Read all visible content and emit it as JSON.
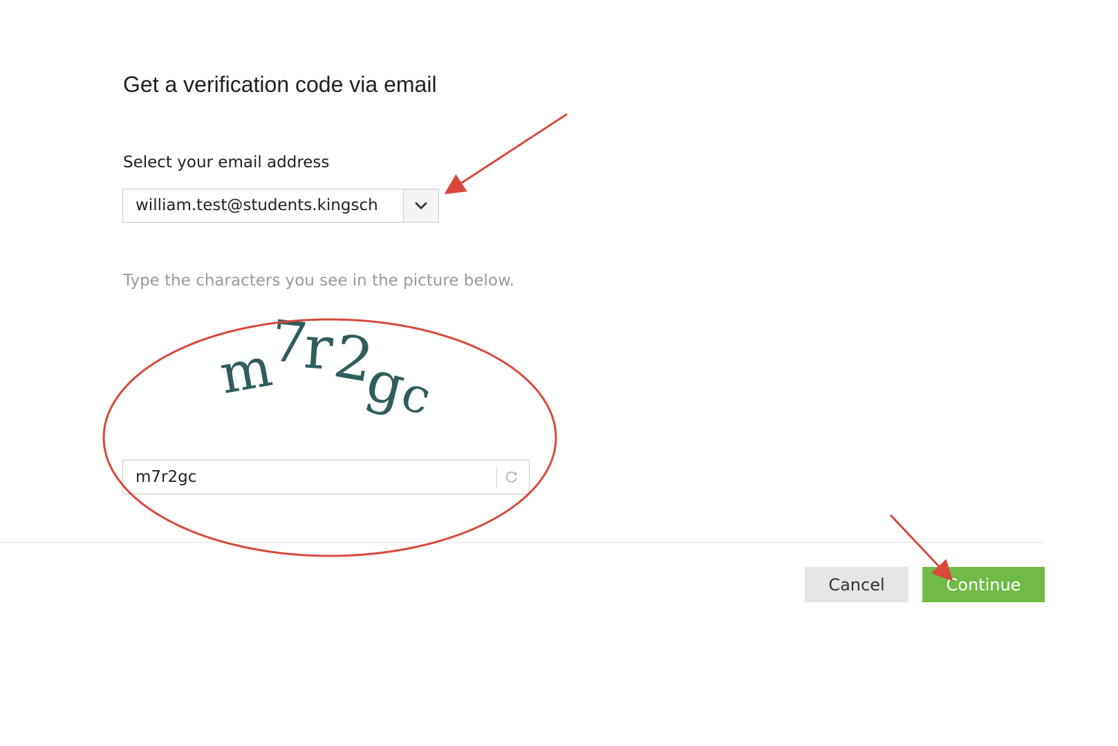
{
  "dialog": {
    "title": "Get a verification code via email"
  },
  "email": {
    "label": "Select your email address",
    "selected_value": "william.test@students.kingsch"
  },
  "captcha": {
    "instruction": "Type the characters you see in the picture below.",
    "image_text": "m7r2gc",
    "input_value": "m7r2gc",
    "text_color": "#2f5d5d"
  },
  "actions": {
    "cancel_label": "Cancel",
    "continue_label": "Continue"
  },
  "colors": {
    "accent_green": "#6fbb46",
    "annotation_red": "#d9483b",
    "cancel_gray": "#e6e6e6"
  },
  "icons": {
    "dropdown": "chevron-down-icon",
    "refresh": "refresh-icon"
  }
}
